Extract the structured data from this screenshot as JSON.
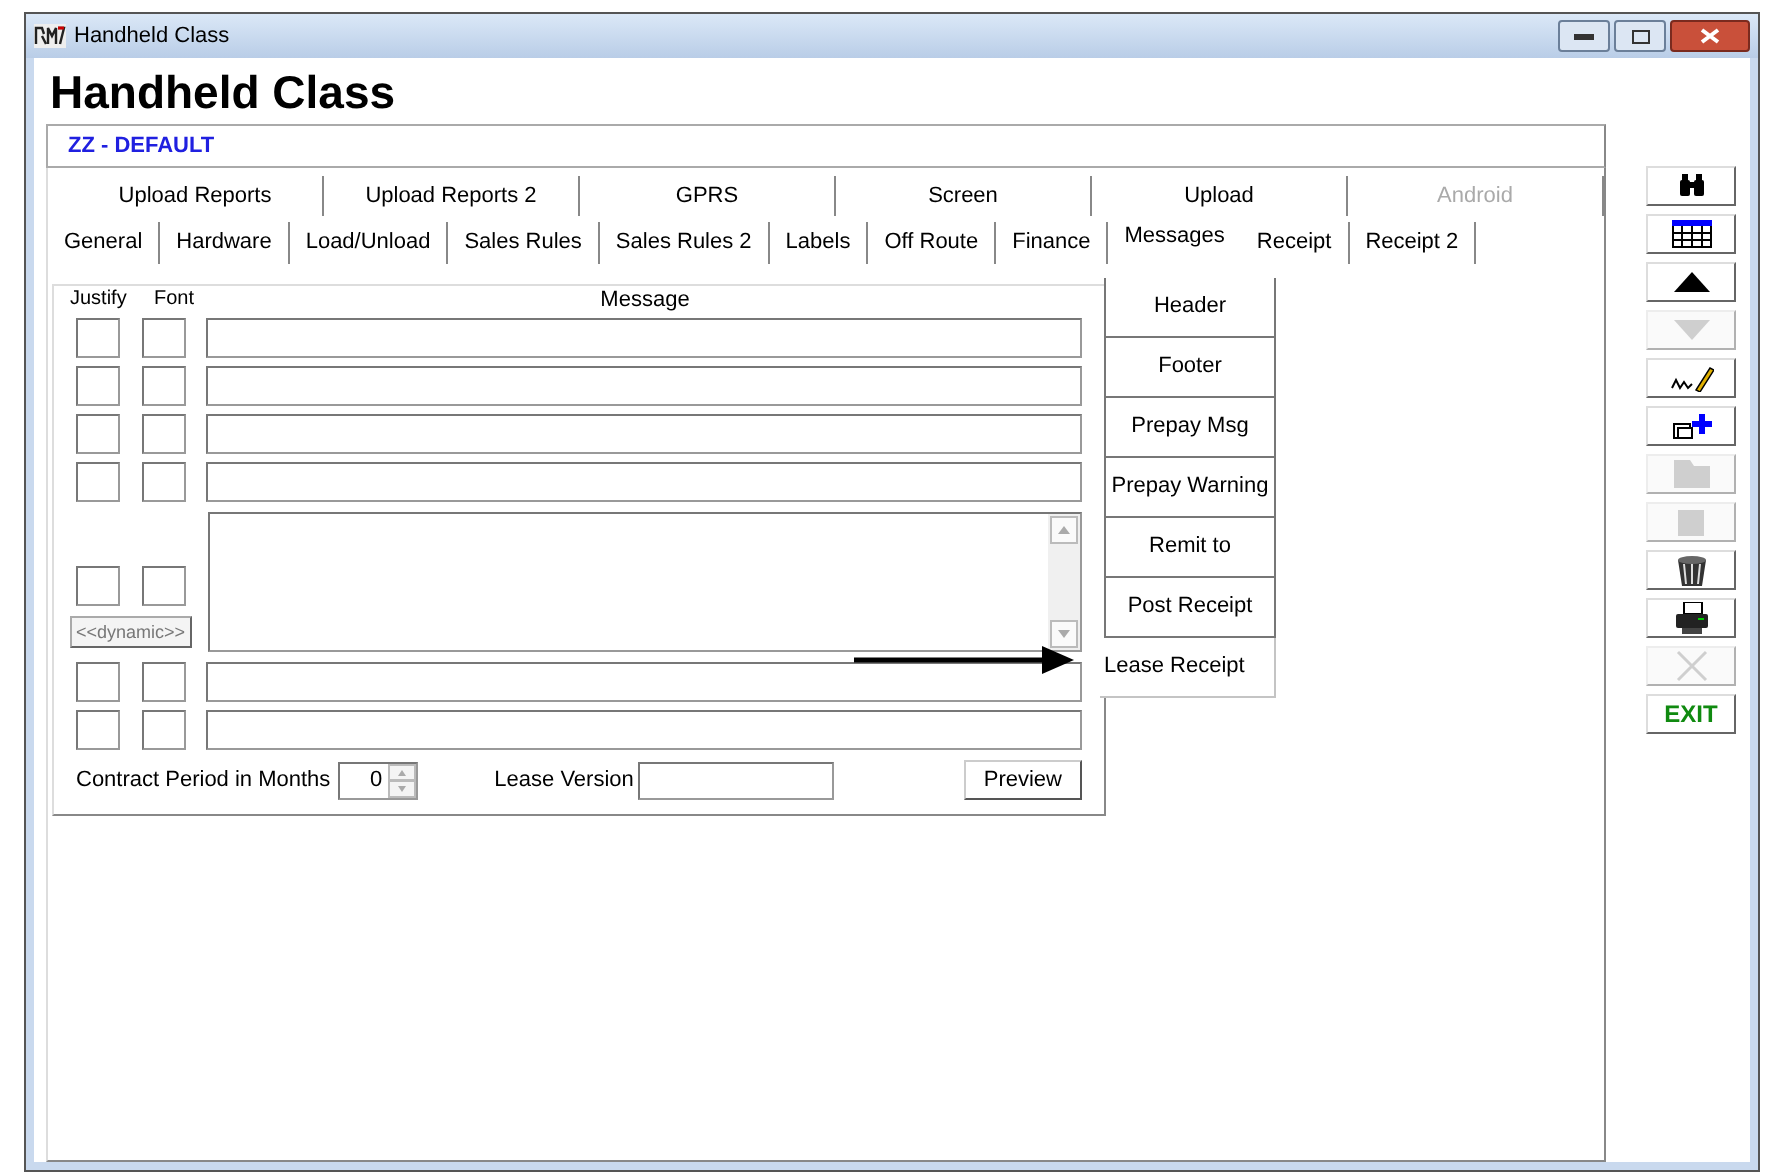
{
  "window": {
    "title": "Handheld Class"
  },
  "heading": "Handheld Class",
  "record": "ZZ - DEFAULT",
  "tabs_row_1": [
    {
      "label": "Upload Reports",
      "selected": false,
      "disabled": false
    },
    {
      "label": "Upload Reports 2",
      "selected": false,
      "disabled": false
    },
    {
      "label": "GPRS",
      "selected": false,
      "disabled": false
    },
    {
      "label": "Screen",
      "selected": false,
      "disabled": false
    },
    {
      "label": "Upload",
      "selected": false,
      "disabled": false
    },
    {
      "label": "Android",
      "selected": false,
      "disabled": true
    }
  ],
  "tabs_row_2": [
    {
      "label": "General",
      "selected": false
    },
    {
      "label": "Hardware",
      "selected": false
    },
    {
      "label": "Load/Unload",
      "selected": false
    },
    {
      "label": "Sales Rules",
      "selected": false
    },
    {
      "label": "Sales Rules 2",
      "selected": false
    },
    {
      "label": "Labels",
      "selected": false
    },
    {
      "label": "Off Route",
      "selected": false
    },
    {
      "label": "Finance",
      "selected": false
    },
    {
      "label": "Messages",
      "selected": true
    },
    {
      "label": "Receipt",
      "selected": false
    },
    {
      "label": "Receipt 2",
      "selected": false
    }
  ],
  "columns": [
    "Justify",
    "Font",
    "Message"
  ],
  "message_rows": [
    {
      "kind": "line"
    },
    {
      "kind": "line"
    },
    {
      "kind": "line"
    },
    {
      "kind": "line"
    },
    {
      "kind": "multiline",
      "button": "<<dynamic>>"
    },
    {
      "kind": "line"
    },
    {
      "kind": "line"
    }
  ],
  "contract_period": {
    "label": "Contract Period in Months",
    "value": "0"
  },
  "lease_version": {
    "label": "Lease Version"
  },
  "preview_button": "Preview",
  "side_tabs": [
    {
      "label": "Header",
      "selected": false
    },
    {
      "label": "Footer",
      "selected": false
    },
    {
      "label": "Prepay Msg",
      "selected": false
    },
    {
      "label": "Prepay Warning",
      "selected": false
    },
    {
      "label": "Remit to",
      "selected": false
    },
    {
      "label": "Post Receipt",
      "selected": false
    },
    {
      "label": "Lease Receipt",
      "selected": true
    }
  ],
  "toolbar": [
    {
      "kind": "binoculars",
      "disabled": false
    },
    {
      "kind": "grid",
      "disabled": false
    },
    {
      "kind": "up",
      "disabled": false
    },
    {
      "kind": "down",
      "disabled": true
    },
    {
      "kind": "signature",
      "disabled": false
    },
    {
      "kind": "add",
      "disabled": false
    },
    {
      "kind": "folder",
      "disabled": true
    },
    {
      "kind": "stop",
      "disabled": true
    },
    {
      "kind": "trash",
      "disabled": false
    },
    {
      "kind": "print",
      "disabled": false
    },
    {
      "kind": "cancel",
      "disabled": true
    },
    {
      "kind": "exit",
      "label": "EXIT",
      "disabled": false
    }
  ]
}
